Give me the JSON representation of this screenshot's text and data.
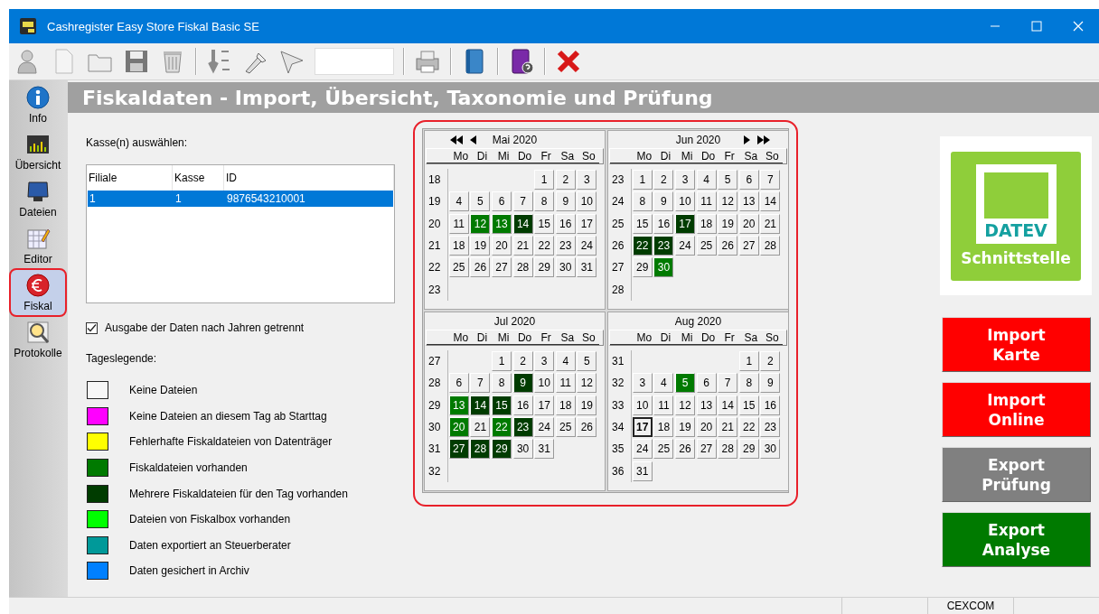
{
  "window": {
    "title": "Cashregister Easy Store Fiskal Basic SE"
  },
  "sidebar": {
    "items": [
      {
        "label": "Info",
        "selected": false
      },
      {
        "label": "Übersicht",
        "selected": false
      },
      {
        "label": "Dateien",
        "selected": false
      },
      {
        "label": "Editor",
        "selected": false
      },
      {
        "label": "Fiskal",
        "selected": true
      },
      {
        "label": "Protokolle",
        "selected": false
      }
    ]
  },
  "header": {
    "title": "Fiskaldaten - Import, Übersicht, Taxonomie und Prüfung"
  },
  "register_select": {
    "label": "Kasse(n) auswählen:",
    "table": {
      "columns": [
        "Filiale",
        "Kasse",
        "ID"
      ],
      "rows": [
        {
          "cells": [
            "1",
            "1",
            "9876543210001"
          ],
          "selected": true
        }
      ]
    }
  },
  "separate_years": {
    "label": "Ausgabe der Daten nach Jahren getrennt",
    "checked": true
  },
  "legend": {
    "title": "Tageslegende:",
    "items": [
      {
        "label": "Keine Dateien",
        "color": "#f7f7f7"
      },
      {
        "label": "Keine Dateien an diesem Tag ab Starttag",
        "color": "#ff00ff"
      },
      {
        "label": "Fehlerhafte Fiskaldateien von Datenträger",
        "color": "#ffff00"
      },
      {
        "label": "Fiskaldateien vorhanden",
        "color": "#007a00"
      },
      {
        "label": "Mehrere Fiskaldateien für den Tag vorhanden",
        "color": "#003c00"
      },
      {
        "label": "Dateien von Fiskalbox vorhanden",
        "color": "#00ff00"
      },
      {
        "label": "Daten exportiert an Steuerberater",
        "color": "#009999"
      },
      {
        "label": "Daten gesichert in Archiv",
        "color": "#0080ff"
      }
    ]
  },
  "calendar": {
    "months": [
      {
        "title": "Mai 2020",
        "prev_arrows": true,
        "next_arrows": false,
        "weekdays": [
          "Mo",
          "Di",
          "Mi",
          "Do",
          "Fr",
          "Sa",
          "So"
        ],
        "weeks": [
          {
            "week": "18",
            "days": [
              {
                "text": "1",
                "color": "#f0f0f0",
                "selected": false
              },
              {
                "text": "2",
                "color": "#f0f0f0",
                "selected": false
              },
              {
                "text": "3",
                "color": "#f0f0f0",
                "selected": false
              }
            ]
          },
          {
            "week": "19",
            "days": [
              {
                "text": "4",
                "color": "#f0f0f0",
                "selected": false
              },
              {
                "text": "5",
                "color": "#f0f0f0",
                "selected": false
              },
              {
                "text": "6",
                "color": "#f0f0f0",
                "selected": false
              },
              {
                "text": "7",
                "color": "#f0f0f0",
                "selected": false
              },
              {
                "text": "8",
                "color": "#f0f0f0",
                "selected": false
              },
              {
                "text": "9",
                "color": "#f0f0f0",
                "selected": false
              },
              {
                "text": "10",
                "color": "#f0f0f0",
                "selected": false
              }
            ]
          },
          {
            "week": "20",
            "days": [
              {
                "text": "11",
                "color": "#f0f0f0",
                "selected": false
              },
              {
                "text": "12",
                "color": "#007a00",
                "selected": false
              },
              {
                "text": "13",
                "color": "#007a00",
                "selected": false
              },
              {
                "text": "14",
                "color": "#003c00",
                "selected": false
              },
              {
                "text": "15",
                "color": "#f0f0f0",
                "selected": false
              },
              {
                "text": "16",
                "color": "#f0f0f0",
                "selected": false
              },
              {
                "text": "17",
                "color": "#f0f0f0",
                "selected": false
              }
            ]
          },
          {
            "week": "21",
            "days": [
              {
                "text": "18",
                "color": "#f0f0f0",
                "selected": false
              },
              {
                "text": "19",
                "color": "#f0f0f0",
                "selected": false
              },
              {
                "text": "20",
                "color": "#f0f0f0",
                "selected": false
              },
              {
                "text": "21",
                "color": "#f0f0f0",
                "selected": false
              },
              {
                "text": "22",
                "color": "#f0f0f0",
                "selected": false
              },
              {
                "text": "23",
                "color": "#f0f0f0",
                "selected": false
              },
              {
                "text": "24",
                "color": "#f0f0f0",
                "selected": false
              }
            ]
          },
          {
            "week": "22",
            "days": [
              {
                "text": "25",
                "color": "#f0f0f0",
                "selected": false
              },
              {
                "text": "26",
                "color": "#f0f0f0",
                "selected": false
              },
              {
                "text": "27",
                "color": "#f0f0f0",
                "selected": false
              },
              {
                "text": "28",
                "color": "#f0f0f0",
                "selected": false
              },
              {
                "text": "29",
                "color": "#f0f0f0",
                "selected": false
              },
              {
                "text": "30",
                "color": "#f0f0f0",
                "selected": false
              },
              {
                "text": "31",
                "color": "#f0f0f0",
                "selected": false
              }
            ]
          },
          {
            "week": "23"
          }
        ]
      },
      {
        "title": "Jun 2020",
        "prev_arrows": false,
        "next_arrows": true,
        "weekdays": [
          "Mo",
          "Di",
          "Mi",
          "Do",
          "Fr",
          "Sa",
          "So"
        ],
        "weeks": [
          {
            "week": "23",
            "days": [
              {
                "text": "1",
                "color": "#f0f0f0",
                "selected": false
              },
              {
                "text": "2",
                "color": "#f0f0f0",
                "selected": false
              },
              {
                "text": "3",
                "color": "#f0f0f0",
                "selected": false
              },
              {
                "text": "4",
                "color": "#f0f0f0",
                "selected": false
              },
              {
                "text": "5",
                "color": "#f0f0f0",
                "selected": false
              },
              {
                "text": "6",
                "color": "#f0f0f0",
                "selected": false
              },
              {
                "text": "7",
                "color": "#f0f0f0",
                "selected": false
              }
            ]
          },
          {
            "week": "24",
            "days": [
              {
                "text": "8",
                "color": "#f0f0f0",
                "selected": false
              },
              {
                "text": "9",
                "color": "#f0f0f0",
                "selected": false
              },
              {
                "text": "10",
                "color": "#f0f0f0",
                "selected": false
              },
              {
                "text": "11",
                "color": "#f0f0f0",
                "selected": false
              },
              {
                "text": "12",
                "color": "#f0f0f0",
                "selected": false
              },
              {
                "text": "13",
                "color": "#f0f0f0",
                "selected": false
              },
              {
                "text": "14",
                "color": "#f0f0f0",
                "selected": false
              }
            ]
          },
          {
            "week": "25",
            "days": [
              {
                "text": "15",
                "color": "#f0f0f0",
                "selected": false
              },
              {
                "text": "16",
                "color": "#f0f0f0",
                "selected": false
              },
              {
                "text": "17",
                "color": "#003c00",
                "selected": false
              },
              {
                "text": "18",
                "color": "#f0f0f0",
                "selected": false
              },
              {
                "text": "19",
                "color": "#f0f0f0",
                "selected": false
              },
              {
                "text": "20",
                "color": "#f0f0f0",
                "selected": false
              },
              {
                "text": "21",
                "color": "#f0f0f0",
                "selected": false
              }
            ]
          },
          {
            "week": "26",
            "days": [
              {
                "text": "22",
                "color": "#003c00",
                "selected": false
              },
              {
                "text": "23",
                "color": "#003c00",
                "selected": false
              },
              {
                "text": "24",
                "color": "#f0f0f0",
                "selected": false
              },
              {
                "text": "25",
                "color": "#f0f0f0",
                "selected": false
              },
              {
                "text": "26",
                "color": "#f0f0f0",
                "selected": false
              },
              {
                "text": "27",
                "color": "#f0f0f0",
                "selected": false
              },
              {
                "text": "28",
                "color": "#f0f0f0",
                "selected": false
              }
            ]
          },
          {
            "week": "27",
            "days": [
              {
                "text": "29",
                "color": "#f0f0f0",
                "selected": false
              },
              {
                "text": "30",
                "color": "#007a00",
                "selected": false
              }
            ]
          },
          {
            "week": "28"
          }
        ]
      },
      {
        "title": "Jul 2020",
        "prev_arrows": false,
        "next_arrows": false,
        "weekdays": [
          "Mo",
          "Di",
          "Mi",
          "Do",
          "Fr",
          "Sa",
          "So"
        ],
        "weeks": [
          {
            "week": "27",
            "days": [
              {
                "text": "1",
                "color": "#f0f0f0",
                "selected": false
              },
              {
                "text": "2",
                "color": "#f0f0f0",
                "selected": false
              },
              {
                "text": "3",
                "color": "#f0f0f0",
                "selected": false
              },
              {
                "text": "4",
                "color": "#f0f0f0",
                "selected": false
              },
              {
                "text": "5",
                "color": "#f0f0f0",
                "selected": false
              }
            ]
          },
          {
            "week": "28",
            "days": [
              {
                "text": "6",
                "color": "#f0f0f0",
                "selected": false
              },
              {
                "text": "7",
                "color": "#f0f0f0",
                "selected": false
              },
              {
                "text": "8",
                "color": "#f0f0f0",
                "selected": false
              },
              {
                "text": "9",
                "color": "#003c00",
                "selected": false
              },
              {
                "text": "10",
                "color": "#f0f0f0",
                "selected": false
              },
              {
                "text": "11",
                "color": "#f0f0f0",
                "selected": false
              },
              {
                "text": "12",
                "color": "#f0f0f0",
                "selected": false
              }
            ]
          },
          {
            "week": "29",
            "days": [
              {
                "text": "13",
                "color": "#007a00",
                "selected": false
              },
              {
                "text": "14",
                "color": "#003c00",
                "selected": false
              },
              {
                "text": "15",
                "color": "#003c00",
                "selected": false
              },
              {
                "text": "16",
                "color": "#f0f0f0",
                "selected": false
              },
              {
                "text": "17",
                "color": "#f0f0f0",
                "selected": false
              },
              {
                "text": "18",
                "color": "#f0f0f0",
                "selected": false
              },
              {
                "text": "19",
                "color": "#f0f0f0",
                "selected": false
              }
            ]
          },
          {
            "week": "30",
            "days": [
              {
                "text": "20",
                "color": "#007a00",
                "selected": false
              },
              {
                "text": "21",
                "color": "#f0f0f0",
                "selected": false
              },
              {
                "text": "22",
                "color": "#007a00",
                "selected": false
              },
              {
                "text": "23",
                "color": "#003c00",
                "selected": false
              },
              {
                "text": "24",
                "color": "#f0f0f0",
                "selected": false
              },
              {
                "text": "25",
                "color": "#f0f0f0",
                "selected": false
              },
              {
                "text": "26",
                "color": "#f0f0f0",
                "selected": false
              }
            ]
          },
          {
            "week": "31",
            "days": [
              {
                "text": "27",
                "color": "#003c00",
                "selected": false
              },
              {
                "text": "28",
                "color": "#003c00",
                "selected": false
              },
              {
                "text": "29",
                "color": "#003c00",
                "selected": false
              },
              {
                "text": "30",
                "color": "#f0f0f0",
                "selected": false
              },
              {
                "text": "31",
                "color": "#f0f0f0",
                "selected": false
              }
            ]
          },
          {
            "week": "32"
          }
        ]
      },
      {
        "title": "Aug 2020",
        "prev_arrows": false,
        "next_arrows": false,
        "weekdays": [
          "Mo",
          "Di",
          "Mi",
          "Do",
          "Fr",
          "Sa",
          "So"
        ],
        "weeks": [
          {
            "week": "31",
            "days": [
              {
                "text": "1",
                "color": "#f0f0f0",
                "selected": false
              },
              {
                "text": "2",
                "color": "#f0f0f0",
                "selected": false
              }
            ]
          },
          {
            "week": "32",
            "days": [
              {
                "text": "3",
                "color": "#f0f0f0",
                "selected": false
              },
              {
                "text": "4",
                "color": "#f0f0f0",
                "selected": false
              },
              {
                "text": "5",
                "color": "#007a00",
                "selected": false
              },
              {
                "text": "6",
                "color": "#f0f0f0",
                "selected": false
              },
              {
                "text": "7",
                "color": "#f0f0f0",
                "selected": false
              },
              {
                "text": "8",
                "color": "#f0f0f0",
                "selected": false
              },
              {
                "text": "9",
                "color": "#f0f0f0",
                "selected": false
              }
            ]
          },
          {
            "week": "33",
            "days": [
              {
                "text": "10",
                "color": "#f0f0f0",
                "selected": false
              },
              {
                "text": "11",
                "color": "#f0f0f0",
                "selected": false
              },
              {
                "text": "12",
                "color": "#f0f0f0",
                "selected": false
              },
              {
                "text": "13",
                "color": "#f0f0f0",
                "selected": false
              },
              {
                "text": "14",
                "color": "#f0f0f0",
                "selected": false
              },
              {
                "text": "15",
                "color": "#f0f0f0",
                "selected": false
              },
              {
                "text": "16",
                "color": "#f0f0f0",
                "selected": false
              }
            ]
          },
          {
            "week": "34",
            "days": [
              {
                "text": "17",
                "color": "#f0f0f0",
                "selected": true
              },
              {
                "text": "18",
                "color": "#f0f0f0",
                "selected": false
              },
              {
                "text": "19",
                "color": "#f0f0f0",
                "selected": false
              },
              {
                "text": "20",
                "color": "#f0f0f0",
                "selected": false
              },
              {
                "text": "21",
                "color": "#f0f0f0",
                "selected": false
              },
              {
                "text": "22",
                "color": "#f0f0f0",
                "selected": false
              },
              {
                "text": "23",
                "color": "#f0f0f0",
                "selected": false
              }
            ]
          },
          {
            "week": "35",
            "days": [
              {
                "text": "24",
                "color": "#f0f0f0",
                "selected": false
              },
              {
                "text": "25",
                "color": "#f0f0f0",
                "selected": false
              },
              {
                "text": "26",
                "color": "#f0f0f0",
                "selected": false
              },
              {
                "text": "27",
                "color": "#f0f0f0",
                "selected": false
              },
              {
                "text": "28",
                "color": "#f0f0f0",
                "selected": false
              },
              {
                "text": "29",
                "color": "#f0f0f0",
                "selected": false
              },
              {
                "text": "30",
                "color": "#f0f0f0",
                "selected": false
              }
            ]
          },
          {
            "week": "36",
            "days": [
              {
                "text": "31",
                "color": "#f0f0f0",
                "selected": false
              }
            ]
          }
        ]
      }
    ]
  },
  "datev_logo": {
    "brand": "DATEV",
    "caption": "Schnittstelle"
  },
  "actions": [
    {
      "lines": [
        "Import",
        "Karte"
      ],
      "color": "#ff0000"
    },
    {
      "lines": [
        "Import",
        "Online"
      ],
      "color": "#ff0000"
    },
    {
      "lines": [
        "Export",
        "Prüfung"
      ],
      "color": "#808080"
    },
    {
      "lines": [
        "Export",
        "Analyse"
      ],
      "color": "#007a00"
    }
  ],
  "status_bar": {
    "panels": [
      "CEXCOM"
    ]
  }
}
